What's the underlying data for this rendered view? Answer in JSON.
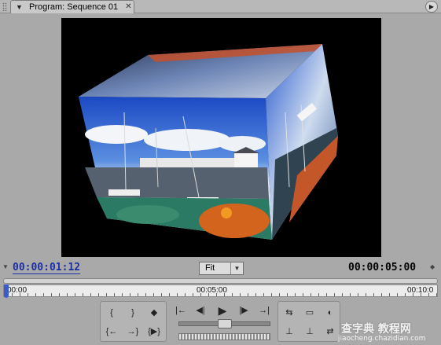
{
  "tab": {
    "title": "Program: Sequence 01",
    "collapse_glyph": "▼",
    "close_glyph": "✕",
    "menu_glyph": "▶"
  },
  "monitor": {
    "frame_description_icon": "rotating-cube-preview",
    "background": "#000000"
  },
  "timecode": {
    "current": "00:00:01:12",
    "duration": "00:00:05:00",
    "view_zoom": "Fit"
  },
  "ruler": {
    "labels": [
      "00:00",
      "00:05:00",
      "00:10:0"
    ]
  },
  "transport": {
    "left_group": [
      {
        "name": "mark-in",
        "glyph": "{"
      },
      {
        "name": "mark-out",
        "glyph": "}"
      },
      {
        "name": "set-marker",
        "glyph": "◆"
      },
      {
        "name": "go-to-in",
        "glyph": "{←"
      },
      {
        "name": "go-to-out",
        "glyph": "→}"
      },
      {
        "name": "play-in-to-out",
        "glyph": "{▶}"
      }
    ],
    "center_group": [
      {
        "name": "previous-marker",
        "glyph": "|←"
      },
      {
        "name": "step-back",
        "glyph": "◀|"
      },
      {
        "name": "play",
        "glyph": "▶"
      },
      {
        "name": "step-forward",
        "glyph": "|▶"
      },
      {
        "name": "next-marker",
        "glyph": "→|"
      }
    ],
    "right_group": [
      {
        "name": "loop",
        "glyph": "⇆"
      },
      {
        "name": "safe-margins",
        "glyph": "▭"
      },
      {
        "name": "output",
        "glyph": "◐"
      },
      {
        "name": "lift",
        "glyph": "⊥"
      },
      {
        "name": "extract",
        "glyph": "⊥"
      },
      {
        "name": "trim",
        "glyph": "⇄"
      }
    ]
  },
  "watermark": {
    "main": "查字典 教程网",
    "sub": "jiaocheng.chazidian.com"
  },
  "colors": {
    "timecode_current": "#1a2fa8",
    "playhead": "#3a5bd0"
  }
}
